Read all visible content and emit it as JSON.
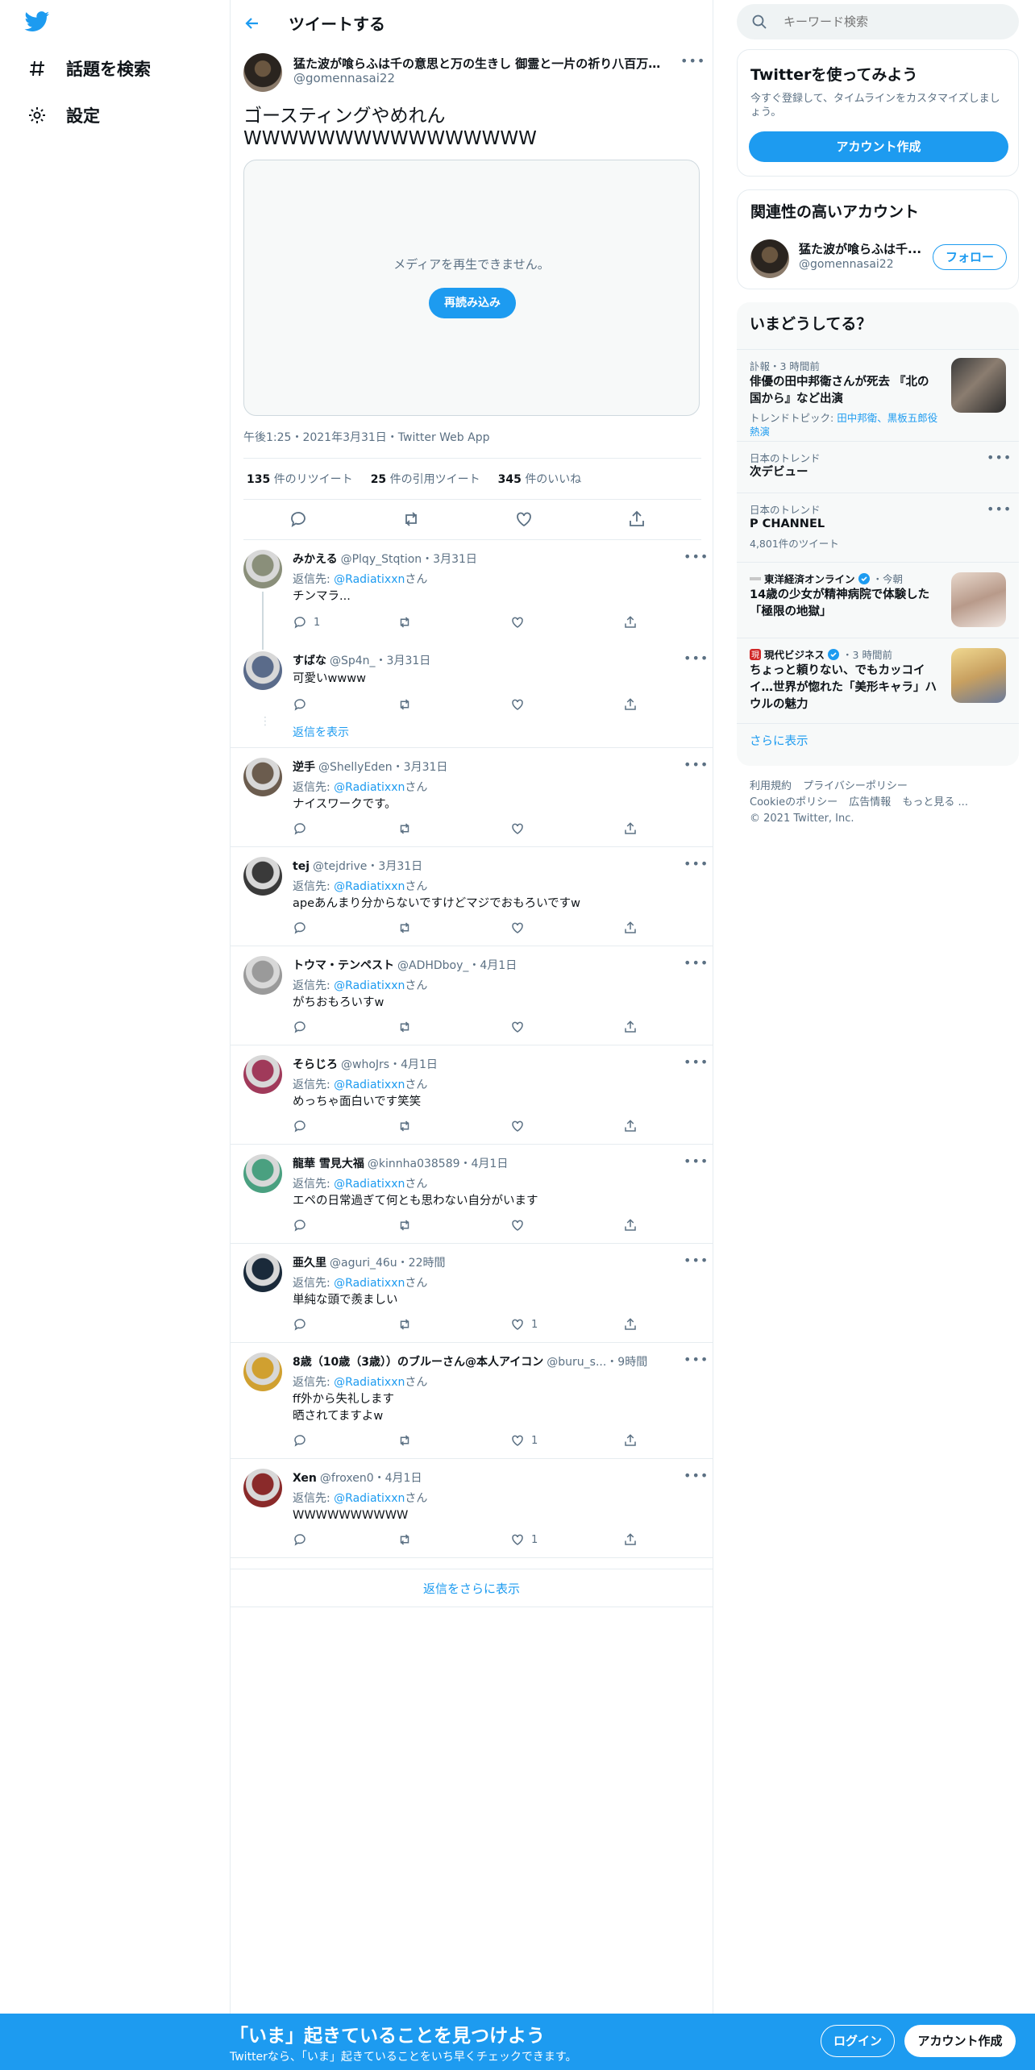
{
  "nav": {
    "explore_label": "話題を検索",
    "settings_label": "設定"
  },
  "header": {
    "title": "ツイートする"
  },
  "main_tweet": {
    "name": "猛た波が喰らふは千の意思と万の生きし 御霊と一片の祈り八百万掬...",
    "handle": "@gomennasai22",
    "text": "ゴースティングやめれん\nWWWWWWWWWWWWWWWW",
    "media_message": "メディアを再生できません。",
    "reload_label": "再読み込み",
    "timestamp": "午後1:25・2021年3月31日・Twitter Web App",
    "retweets_count": "135",
    "retweets_label": "件のリツイート",
    "quotes_count": "25",
    "quotes_label": "件の引用ツイート",
    "likes_count": "345",
    "likes_label": "件のいいね"
  },
  "replies": [
    {
      "name": "みかえる",
      "meta": "@Plqy_Stqtion・3月31日",
      "reply_prefix": "返信先: ",
      "reply_handle": "@Radiatixxn",
      "reply_suffix": "さん",
      "text": "チンマラ...",
      "reply_count": "1",
      "like_count": ""
    },
    {
      "name": "すばな",
      "meta": "@Sp4n_・3月31日",
      "text": "可愛いwwww",
      "reply_count": "",
      "like_count": ""
    },
    {
      "name": "逆手",
      "meta": "@ShellyEden・3月31日",
      "reply_prefix": "返信先: ",
      "reply_handle": "@Radiatixxn",
      "reply_suffix": "さん",
      "text": "ナイスワークです。",
      "reply_count": "",
      "like_count": ""
    },
    {
      "name": "tej",
      "meta": "@tejdrive・3月31日",
      "reply_prefix": "返信先: ",
      "reply_handle": "@Radiatixxn",
      "reply_suffix": "さん",
      "text": "apeあんまり分からないですけどマジでおもろいですw",
      "reply_count": "",
      "like_count": ""
    },
    {
      "name": "トウマ・テンペスト",
      "meta": "@ADHDboy_・4月1日",
      "reply_prefix": "返信先: ",
      "reply_handle": "@Radiatixxn",
      "reply_suffix": "さん",
      "text": "がちおもろいすw",
      "reply_count": "",
      "like_count": ""
    },
    {
      "name": "そらじろ",
      "meta": "@whoJrs・4月1日",
      "reply_prefix": "返信先: ",
      "reply_handle": "@Radiatixxn",
      "reply_suffix": "さん",
      "text": "めっちゃ面白いです笑笑",
      "reply_count": "",
      "like_count": ""
    },
    {
      "name": "龍華 雪見大福",
      "meta": "@kinnha038589・4月1日",
      "reply_prefix": "返信先: ",
      "reply_handle": "@Radiatixxn",
      "reply_suffix": "さん",
      "text": "エペの日常過ぎて何とも思わない自分がいます",
      "reply_count": "",
      "like_count": ""
    },
    {
      "name": "亜久里",
      "meta": "@aguri_46u・22時間",
      "reply_prefix": "返信先: ",
      "reply_handle": "@Radiatixxn",
      "reply_suffix": "さん",
      "text": "単純な頭で羨ましい",
      "reply_count": "",
      "like_count": "1"
    },
    {
      "name": "8歳（10歳（3歳））のブルーさん@本人アイコン",
      "meta": "@buru_s...・9時間",
      "reply_prefix": "返信先: ",
      "reply_handle": "@Radiatixxn",
      "reply_suffix": "さん",
      "text": "ff外から失礼します\n晒されてますよw",
      "reply_count": "",
      "like_count": "1"
    },
    {
      "name": "Xen",
      "meta": "@froxen0・4月1日",
      "reply_prefix": "返信先: ",
      "reply_handle": "@Radiatixxn",
      "reply_suffix": "さん",
      "text": "WWWWWWWWWW",
      "reply_count": "",
      "like_count": "1"
    }
  ],
  "show_replies_label": "返信を表示",
  "show_more_replies_label": "返信をさらに表示",
  "search": {
    "placeholder": "キーワード検索"
  },
  "signup_card": {
    "title": "Twitterを使ってみよう",
    "description": "今すぐ登録して、タイムラインをカスタマイズしましょう。",
    "button": "アカウント作成"
  },
  "related": {
    "title": "関連性の高いアカウント",
    "name": "猛た波が喰らふは千...",
    "handle": "@gomennasai22",
    "follow_label": "フォロー"
  },
  "trends": {
    "title": "いまどうしてる？",
    "items": [
      {
        "meta": "訃報・3 時間前",
        "name": "俳優の田中邦衛さんが死去 『北の国から』など出演",
        "sub_prefix": "トレンドトピック: ",
        "sub_link": "田中邦衛、黒板五郎役熱演"
      },
      {
        "meta": "日本のトレンド",
        "name": "次デビュー"
      },
      {
        "meta": "日本のトレンド",
        "name": "P CHANNEL",
        "sub": "4,801件のツイート"
      },
      {
        "source": "東洋経済オンライン",
        "time": "・今朝",
        "name": "14歳の少女が精神病院で体験した「極限の地獄」"
      },
      {
        "source": "現代ビジネス",
        "time": "・3 時間前",
        "name": "ちょっと頼りない、でもカッコイイ…世界が惚れた「美形キャラ」ハウルの魅力"
      }
    ],
    "more_label": "さらに表示"
  },
  "footer": {
    "links": [
      "利用規約",
      "プライバシーポリシー",
      "Cookieのポリシー",
      "広告情報",
      "もっと見る ..."
    ],
    "copyright": "© 2021 Twitter, Inc."
  },
  "bottom_bar": {
    "title": "「いま」起きていることを見つけよう",
    "subtitle": "Twitterなら、「いま」起きていることをいち早くチェックできます。",
    "login_label": "ログイン",
    "signup_label": "アカウント作成"
  },
  "colors": {
    "accent": "#1d9bf0",
    "text": "#0f1419",
    "secondary": "#5b7083",
    "border": "#e6ecf0"
  }
}
